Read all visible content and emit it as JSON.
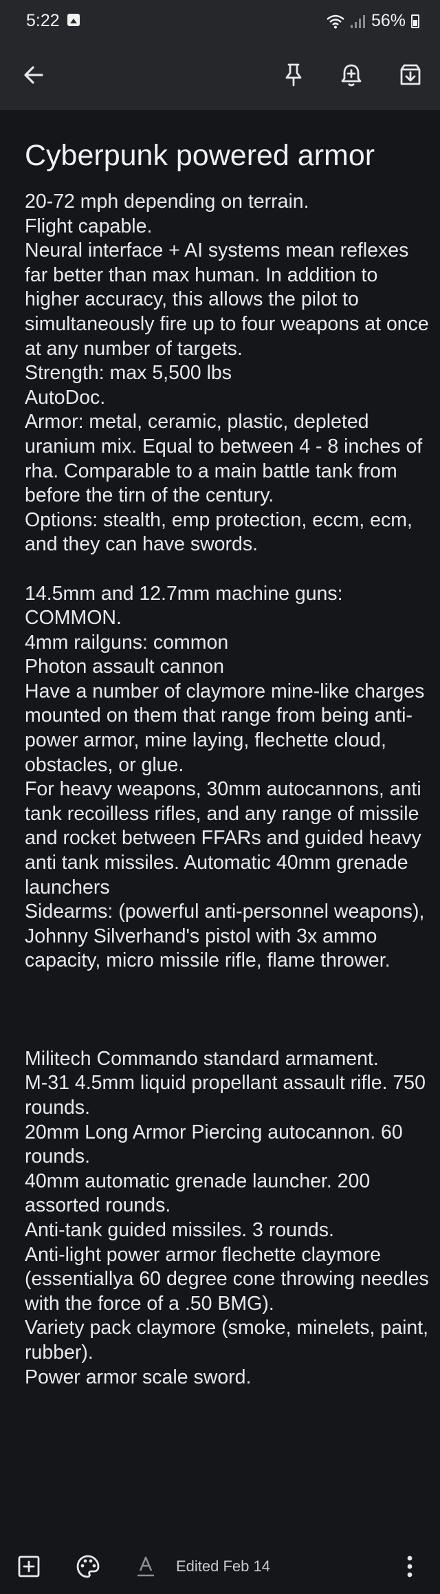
{
  "status_bar": {
    "time": "5:22",
    "battery": "56%",
    "icons": [
      "gallery-icon",
      "wifi-icon",
      "signal-icon",
      "battery-icon"
    ]
  },
  "top_bar": {
    "icons": [
      "back-arrow-icon",
      "pin-icon",
      "add-reminder-icon",
      "archive-icon"
    ]
  },
  "note": {
    "title": "Cyberpunk powered armor",
    "body": "20-72 mph depending on terrain.\nFlight capable.\nNeural interface + AI systems mean reflexes far better than max human. In addition to higher accuracy, this allows the pilot to simultaneously fire up to four weapons at once at any number of targets.\nStrength: max 5,500 lbs\nAutoDoc.\nArmor: metal, ceramic, plastic, depleted uranium mix. Equal to between 4 - 8 inches of rha. Comparable to a main battle tank from before the tirn of the century.\nOptions: stealth, emp protection, eccm, ecm, and they can have swords.\n\n14.5mm and 12.7mm machine guns: COMMON.\n4mm railguns: common\nPhoton assault cannon\nHave a number of claymore mine-like charges mounted on them that range from being anti-power armor, mine laying, flechette cloud, obstacles, or glue.\nFor heavy weapons, 30mm autocannons, anti tank recoilless rifles, and any range of missile and rocket between FFARs and guided heavy anti tank missiles. Automatic 40mm grenade launchers\nSidearms: (powerful anti-personnel weapons), Johnny Silverhand's pistol with 3x ammo capacity, micro missile rifle, flame thrower.\n\n\n\nMilitech Commando standard armament.\nM-31 4.5mm liquid propellant assault rifle. 750 rounds.\n20mm Long Armor Piercing autocannon. 60 rounds.\n40mm automatic grenade launcher. 200 assorted rounds.\nAnti-tank guided missiles. 3 rounds.\nAnti-light power armor flechette claymore (essentiallya 60 degree cone throwing needles with the force of a .50 BMG).\nVariety pack claymore (smoke, minelets, paint, rubber).\nPower armor scale sword."
  },
  "bottom_bar": {
    "edited": "Edited Feb 14",
    "icons": [
      "add-box-icon",
      "palette-icon",
      "text-format-icon",
      "more-vert-icon"
    ]
  },
  "colors": {
    "background": "#151619",
    "toolbar": "#25272b",
    "text": "#e8e9ed"
  }
}
